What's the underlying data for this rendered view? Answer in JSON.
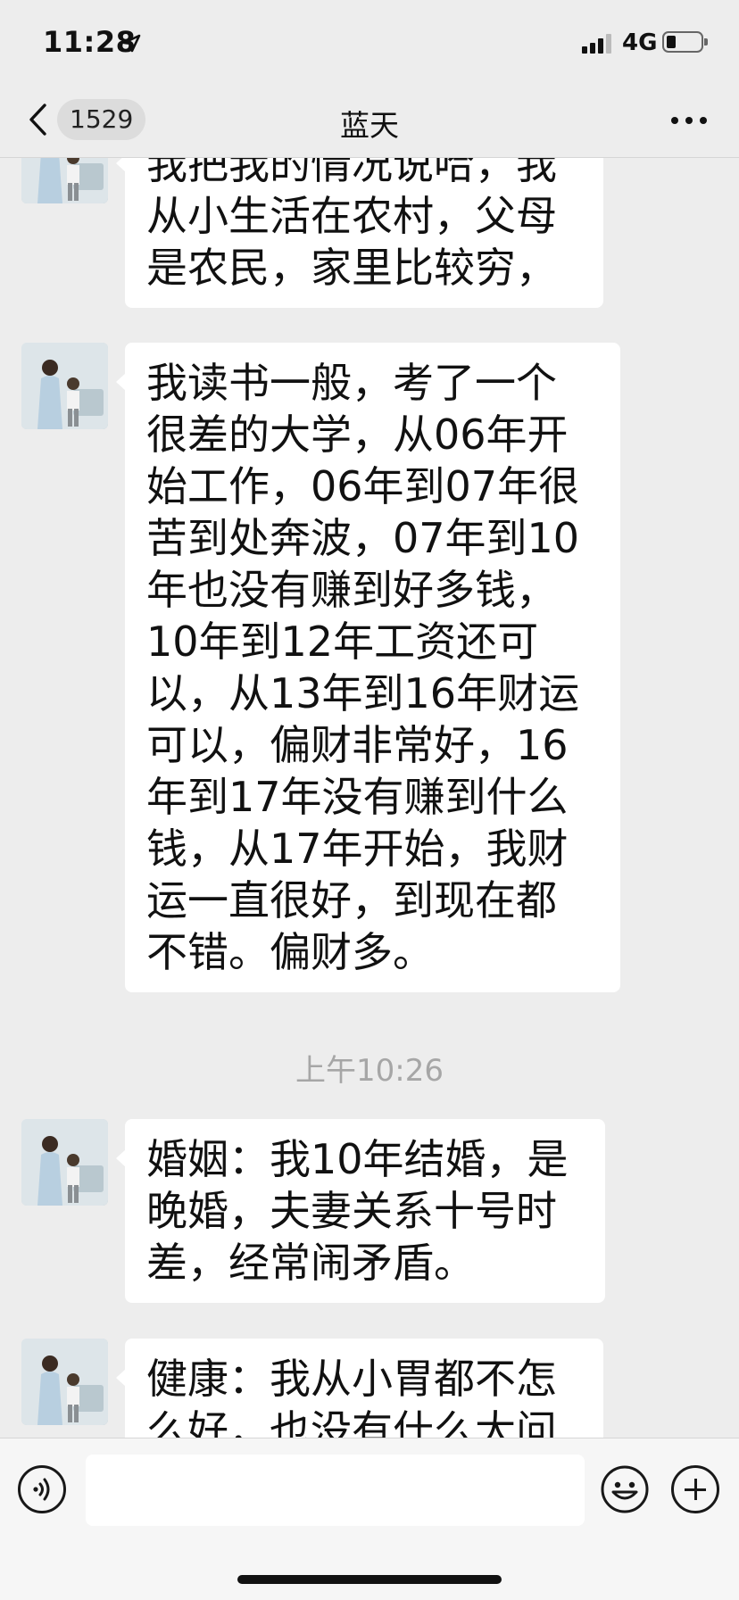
{
  "status_bar": {
    "time": "11:28",
    "network": "4G"
  },
  "nav": {
    "unread_count": "1529",
    "title": "蓝天"
  },
  "messages": [
    {
      "text": "我把我的情况说哈，我\n从小生活在农村，父母\n是农民，家里比较穷，",
      "avatar": "contact-avatar"
    },
    {
      "text": "我读书一般，考了一个\n很差的大学，从06年开\n始工作，06年到07年很\n苦到处奔波，07年到10\n年也没有赚到好多钱，\n10年到12年工资还可\n以，从13年到16年财运\n可以，偏财非常好，16\n年到17年没有赚到什么\n钱，从17年开始，我财\n运一直很好，到现在都\n不错。偏财多。",
      "avatar": "contact-avatar"
    },
    {
      "text": "婚姻：我10年结婚，是\n晚婚，夫妻关系十号时\n差，经常闹矛盾。",
      "avatar": "contact-avatar"
    },
    {
      "text": "健康：我从小胃都不怎\n么好，也没有什么大问",
      "avatar": "contact-avatar"
    }
  ],
  "timestamp": "上午10:26",
  "input": {
    "placeholder": ""
  },
  "icons": [
    "back-icon",
    "more-icon",
    "voice-icon",
    "emoji-icon",
    "plus-icon",
    "location-arrow-icon",
    "signal-icon",
    "battery-icon"
  ]
}
